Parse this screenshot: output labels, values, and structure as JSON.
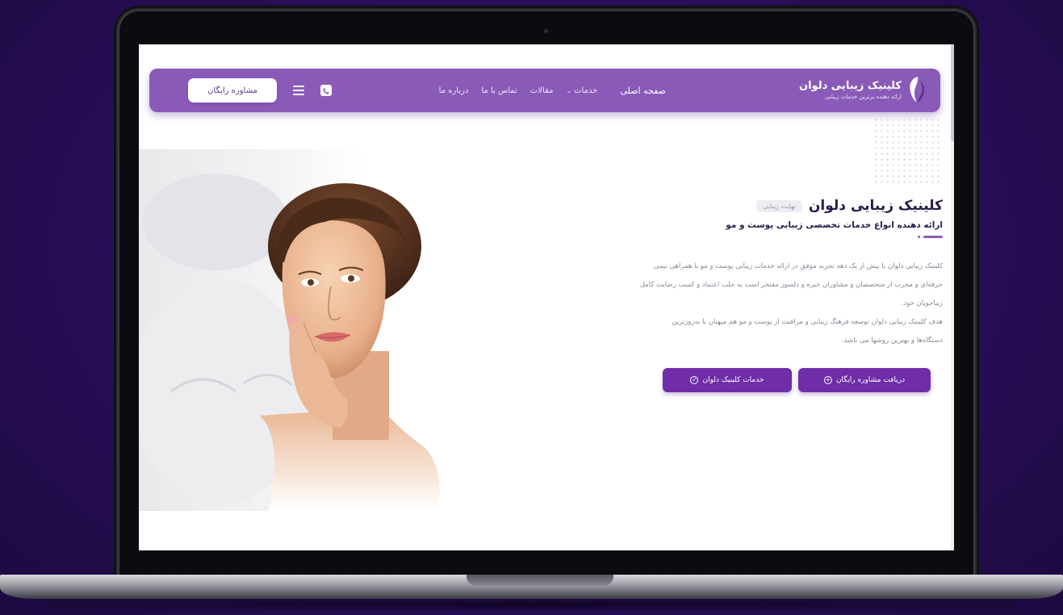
{
  "colors": {
    "brand_purple": "#8a5ab8",
    "button_purple": "#6f2ea8",
    "heading_dark": "#2a1a4a",
    "body_gray": "#8a8696",
    "background_deep_purple": "#2a0f5c"
  },
  "navbar": {
    "brand_name": "کلینیک زیبایی دلوان",
    "brand_tagline": "ارائه دهنده برترین خدمات زیبایی",
    "brand_icon": "woman-silhouette-logo",
    "links": [
      {
        "label": "صفحه اصلی",
        "dropdown": false
      },
      {
        "label": "خدمات",
        "dropdown": true
      },
      {
        "label": "مقالات",
        "dropdown": false
      },
      {
        "label": "تماس با ما",
        "dropdown": false
      },
      {
        "label": "درباره ما",
        "dropdown": false
      }
    ],
    "menu_icon": "hamburger-menu-icon",
    "phone_icon": "phone-icon",
    "consult_button": "مشاوره رایگان"
  },
  "hero": {
    "title": "کلینیک زیبایی دلوان",
    "badge": "نهایت زیبایی",
    "subtitle": "ارائه دهنده انواع خدمات تخصصی زیبایی پوست و مو",
    "paragraph_1_line_1": "کلینیک زیبایی دلوان با بیش از یک دهه تجربه موفق در ارائه خدمات زیبایی پوست و مو با همراهی تیمی",
    "paragraph_1_line_2": "حرفه‌ای و مجرب از متخصصان و مشاوران خبره و دلسوز مفتخر است به جلب اعتماد و کسب رضایت کامل",
    "paragraph_1_line_3": "زیباجویان خود.",
    "paragraph_2_line_1": "هدف کلینیک زیبایی دلوان توسعه فرهنگ زیبایی و مراقبت از پوست و مو هم میهنان با به‌روزترین",
    "paragraph_2_line_2": "دستگاه‌ها و بهترین روشها می باشد.",
    "buttons": [
      {
        "label": "دریافت مشاوره رایگان",
        "icon": "plus-circle-icon",
        "glyph": "+"
      },
      {
        "label": "خدمات کلینیک دلوان",
        "icon": "check-circle-icon",
        "glyph": "✓"
      }
    ]
  }
}
